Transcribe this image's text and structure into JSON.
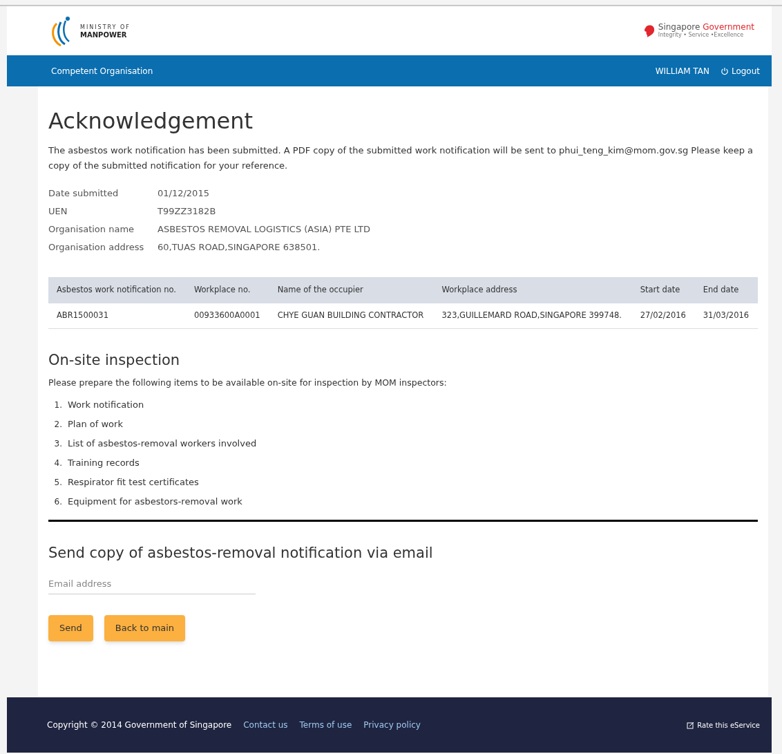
{
  "header": {
    "logo_lines": [
      "MINISTRY OF",
      "MANPOWER"
    ],
    "gov_logo": {
      "name_parts": [
        "Singapore",
        "Government"
      ],
      "tagline": "Integrity • Service •Excellence"
    }
  },
  "nav": {
    "title": "Competent Organisation",
    "user": "WILLIAM TAN",
    "logout": "Logout"
  },
  "title": "Acknowledgement",
  "intro": "The asbestos work notification has been submitted. A PDF copy of the submitted work notification will be sent to phui_teng_kim@mom.gov.sg Please keep a copy of the submitted notification for your reference.",
  "details": [
    {
      "label": "Date submitted",
      "value": "01/12/2015"
    },
    {
      "label": "UEN",
      "value": "T99ZZ3182B"
    },
    {
      "label": "Organisation name",
      "value": "ASBESTOS REMOVAL LOGISTICS (ASIA) PTE LTD"
    },
    {
      "label": "Organisation address",
      "value": "60,TUAS ROAD,SINGAPORE 638501."
    }
  ],
  "table": {
    "columns": [
      "Asbestos work notification no.",
      "Workplace no.",
      "Name of the occupier",
      "Workplace address",
      "Start date",
      "End date"
    ],
    "rows": [
      [
        "ABR1500031",
        "00933600A0001",
        "CHYE GUAN BUILDING CONTRACTOR",
        "323,GUILLEMARD ROAD,SINGAPORE 399748.",
        "27/02/2016",
        "31/03/2016"
      ]
    ]
  },
  "inspection": {
    "heading": "On-site inspection",
    "text": "Please prepare the following items to be available on-site for inspection by MOM inspectors:",
    "items": [
      {
        "number": "1.",
        "text": "Work notification"
      },
      {
        "number": "2.",
        "text": "Plan of work"
      },
      {
        "number": "3.",
        "text": "List of asbestos-removal workers involved"
      },
      {
        "number": "4.",
        "text": "Training records"
      },
      {
        "number": "5.",
        "text": "Respirator fit test certificates"
      },
      {
        "number": "6.",
        "text": "Equipment for asbestors-removal work"
      }
    ]
  },
  "email": {
    "heading": "Send copy of asbestos-removal notification via email",
    "placeholder": "Email address",
    "buttons": [
      "Send",
      "Back to main"
    ]
  },
  "footer": {
    "copyright": "Copyright © 2014 Government of Singapore",
    "links": [
      "Contact us",
      "Terms of use",
      "Privacy policy"
    ],
    "rate": "Rate this eService"
  }
}
